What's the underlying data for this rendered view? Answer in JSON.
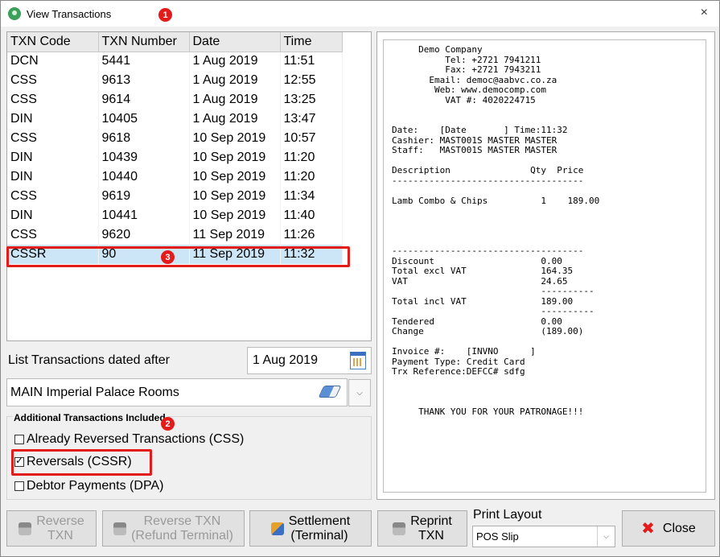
{
  "window": {
    "title": "View Transactions",
    "close_glyph": "×"
  },
  "markers": [
    "1",
    "2",
    "3"
  ],
  "table": {
    "headers": [
      "TXN Code",
      "TXN Number",
      "Date",
      "Time"
    ],
    "rows": [
      [
        "DCN",
        "5441",
        "1 Aug 2019",
        "11:51"
      ],
      [
        "CSS",
        "9613",
        "1 Aug 2019",
        "12:55"
      ],
      [
        "CSS",
        "9614",
        "1 Aug 2019",
        "13:25"
      ],
      [
        "DIN",
        "10405",
        "1 Aug 2019",
        "13:47"
      ],
      [
        "CSS",
        "9618",
        "10 Sep 2019",
        "10:57"
      ],
      [
        "DIN",
        "10439",
        "10 Sep 2019",
        "11:20"
      ],
      [
        "DIN",
        "10440",
        "10 Sep 2019",
        "11:20"
      ],
      [
        "CSS",
        "9619",
        "10 Sep 2019",
        "11:34"
      ],
      [
        "DIN",
        "10441",
        "10 Sep 2019",
        "11:40"
      ],
      [
        "CSS",
        "9620",
        "11 Sep 2019",
        "11:26"
      ],
      [
        "CSSR",
        "90",
        "11 Sep 2019",
        "11:32"
      ]
    ],
    "selected_index": 10
  },
  "filter": {
    "date_label": "List Transactions dated after",
    "date_value": "1 Aug 2019",
    "room_value": "MAIN Imperial Palace Rooms"
  },
  "additional": {
    "label": "Additional Transactions Included",
    "options": [
      {
        "label": "Already Reversed Transactions (CSS)",
        "checked": false
      },
      {
        "label": "Reversals (CSSR)",
        "checked": true
      },
      {
        "label": "Debtor Payments (DPA)",
        "checked": false
      }
    ]
  },
  "buttons": {
    "reverse_txn": [
      "Reverse",
      "TXN"
    ],
    "reverse_refund": [
      "Reverse TXN",
      "(Refund Terminal)"
    ],
    "settlement": [
      "Settlement",
      "(Terminal)"
    ],
    "reprint": [
      "Reprint",
      "TXN"
    ],
    "close": "Close",
    "close_glyph": "✖"
  },
  "print_layout": {
    "label": "Print Layout",
    "value": "POS Slip"
  },
  "receipt": {
    "lines": [
      "     Demo Company",
      "          Tel: +2721 7941211",
      "          Fax: +2721 7943211",
      "       Email: democ@aabvc.co.za",
      "        Web: www.democomp.com",
      "          VAT #: 4020224715",
      "",
      "",
      "Date:    [Date       ] Time:11:32",
      "Cashier: MAST001S MASTER MASTER",
      "Staff:   MAST001S MASTER MASTER",
      "",
      "Description               Qty  Price",
      "------------------------------------",
      "",
      "Lamb Combo & Chips          1    189.00",
      "",
      "",
      "",
      "",
      "------------------------------------",
      "Discount                    0.00",
      "Total excl VAT              164.35",
      "VAT                         24.65",
      "                            ----------",
      "Total incl VAT              189.00",
      "                            ----------",
      "Tendered                    0.00",
      "Change                      (189.00)",
      "",
      "Invoice #:    [INVNO      ]",
      "Payment Type: Credit Card",
      "Trx Reference:DEFCC# sdfg",
      "",
      "",
      "",
      "     THANK YOU FOR YOUR PATRONAGE!!!"
    ]
  }
}
